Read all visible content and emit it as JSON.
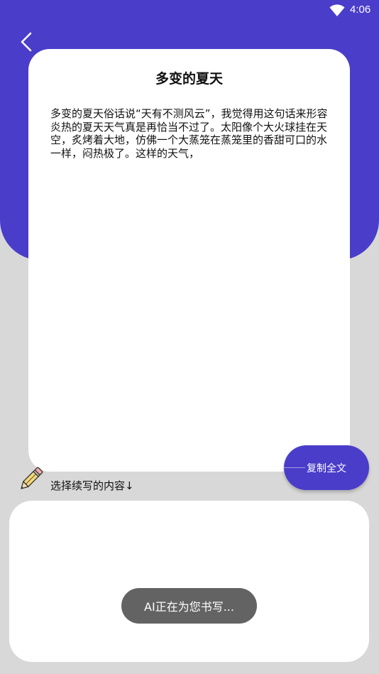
{
  "status_bar": {
    "time": "4:06",
    "wifi_icon": "wifi-icon"
  },
  "header": {
    "back_icon": "chevron-left-icon",
    "accent_color": "#4a3dc9"
  },
  "article": {
    "title": "多变的夏天",
    "body": "多变的夏天俗话说“天有不测风云”，我觉得用这句话来形容炎热的夏天天气真是再恰当不过了。太阳像个大火球挂在天空，炙烤着大地，仿佛一个大蒸笼在蒸笼里的香甜可口的水一样，闷热极了。这样的天气，"
  },
  "actions": {
    "copy_all_label": "复制全文"
  },
  "continue_section": {
    "label": "选择续写的内容↓",
    "icon": "pencil-icon"
  },
  "toast": {
    "message": "AI正在为您书写..."
  }
}
